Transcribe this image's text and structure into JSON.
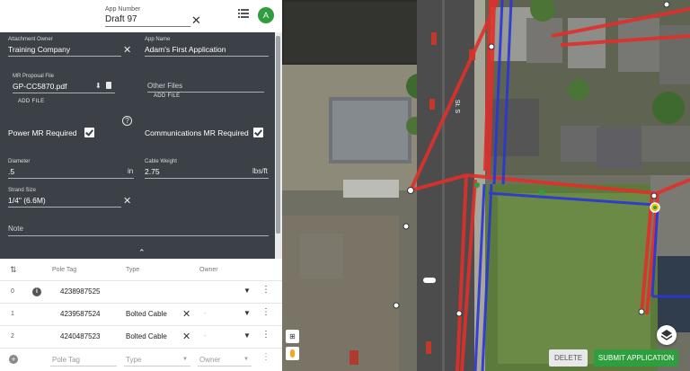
{
  "header": {
    "app_number_label": "App Number",
    "app_number_value": "Draft 97",
    "avatar_initial": "A"
  },
  "form": {
    "attachment_owner_label": "Attachment Owner",
    "attachment_owner_value": "Training Company",
    "app_name_label": "App Name",
    "app_name_value": "Adam's First Application",
    "mr_proposal_label": "MR Proposal File",
    "mr_proposal_value": "GP-CC5870.pdf",
    "add_file_label": "ADD FILE",
    "other_files_placeholder": "Other Files",
    "add_file_label_2": "ADD FILE",
    "power_mr_label": "Power MR Required",
    "power_mr_checked": true,
    "comm_mr_label": "Communications MR Required",
    "comm_mr_checked": true,
    "diameter_label": "Diameter",
    "diameter_value": ".5",
    "diameter_unit": "in",
    "cable_weight_label": "Cable Weight",
    "cable_weight_value": "2.75",
    "cable_weight_unit": "lbs/ft",
    "strand_size_label": "Strand Size",
    "strand_size_value": "1/4\" (6.6M)",
    "note_placeholder": "Note"
  },
  "table": {
    "headers": {
      "pole_tag": "Pole Tag",
      "type": "Type",
      "owner": "Owner"
    },
    "rows": [
      {
        "index": "0",
        "pole_tag": "4238987525",
        "type": "",
        "owner": ""
      },
      {
        "index": "1",
        "pole_tag": "4239587524",
        "type": "Bolted Cable",
        "owner": "-"
      },
      {
        "index": "2",
        "pole_tag": "4240487523",
        "type": "Bolted Cable",
        "owner": "-"
      }
    ],
    "new_row": {
      "pole_tag_placeholder": "Pole Tag",
      "type_placeholder": "Type",
      "owner_placeholder": "Owner"
    }
  },
  "map": {
    "street_label": "St. S",
    "delete_label": "DELETE",
    "submit_label": "SUBMIT APPLICATION",
    "colors": {
      "power_line": "#e0302a",
      "comm_line": "#2a36d6",
      "submit": "#2e9e3e"
    }
  }
}
